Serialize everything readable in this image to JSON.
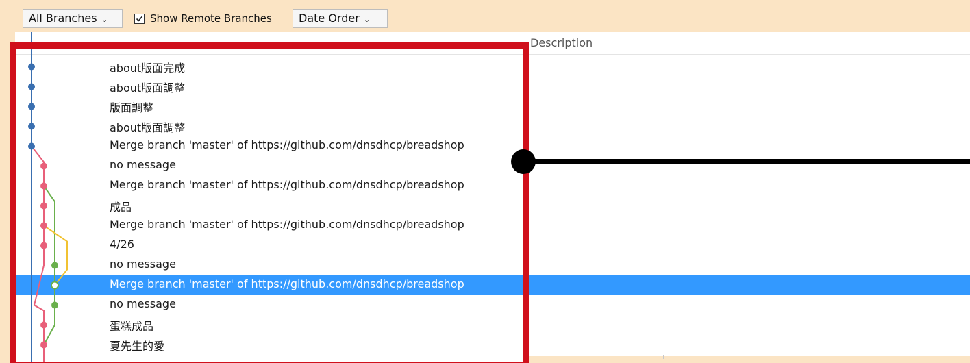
{
  "toolbar": {
    "branch_filter": "All Branches",
    "show_remote_label": "Show Remote Branches",
    "show_remote_checked": true,
    "sort_order": "Date Order"
  },
  "columns": {
    "description": "Description"
  },
  "commits": [
    {
      "message": "about版面完成",
      "lane": 0,
      "color": "#3a6fb0"
    },
    {
      "message": "about版面調整",
      "lane": 0,
      "color": "#3a6fb0"
    },
    {
      "message": "版面調整",
      "lane": 0,
      "color": "#3a6fb0"
    },
    {
      "message": "about版面調整",
      "lane": 0,
      "color": "#3a6fb0"
    },
    {
      "message": "Merge branch 'master' of https://github.com/dnsdhcp/breadshop",
      "lane": 0,
      "color": "#3a6fb0"
    },
    {
      "message": "no message",
      "lane": 1,
      "color": "#e8607a"
    },
    {
      "message": "Merge branch 'master' of https://github.com/dnsdhcp/breadshop",
      "lane": 1,
      "color": "#e8607a"
    },
    {
      "message": "成品",
      "lane": 1,
      "color": "#e8607a"
    },
    {
      "message": "Merge branch 'master' of https://github.com/dnsdhcp/breadshop",
      "lane": 1,
      "color": "#e8607a"
    },
    {
      "message": "4/26",
      "lane": 1,
      "color": "#e8607a"
    },
    {
      "message": "no message",
      "lane": 2,
      "color": "#6ab04c"
    },
    {
      "message": "Merge branch 'master' of https://github.com/dnsdhcp/breadshop",
      "lane": 2,
      "color": "#6ab04c",
      "selected": true
    },
    {
      "message": "no message",
      "lane": 2,
      "color": "#6ab04c"
    },
    {
      "message": "蛋糕成品",
      "lane": 1,
      "color": "#e8607a"
    },
    {
      "message": "夏先生的愛",
      "lane": 1,
      "color": "#e8607a"
    }
  ],
  "colors": {
    "blue": "#3a6fb0",
    "pink": "#e8607a",
    "green": "#6ab04c",
    "yellow": "#f1c232",
    "selection": "#3399ff",
    "highlight": "#d0101c"
  }
}
